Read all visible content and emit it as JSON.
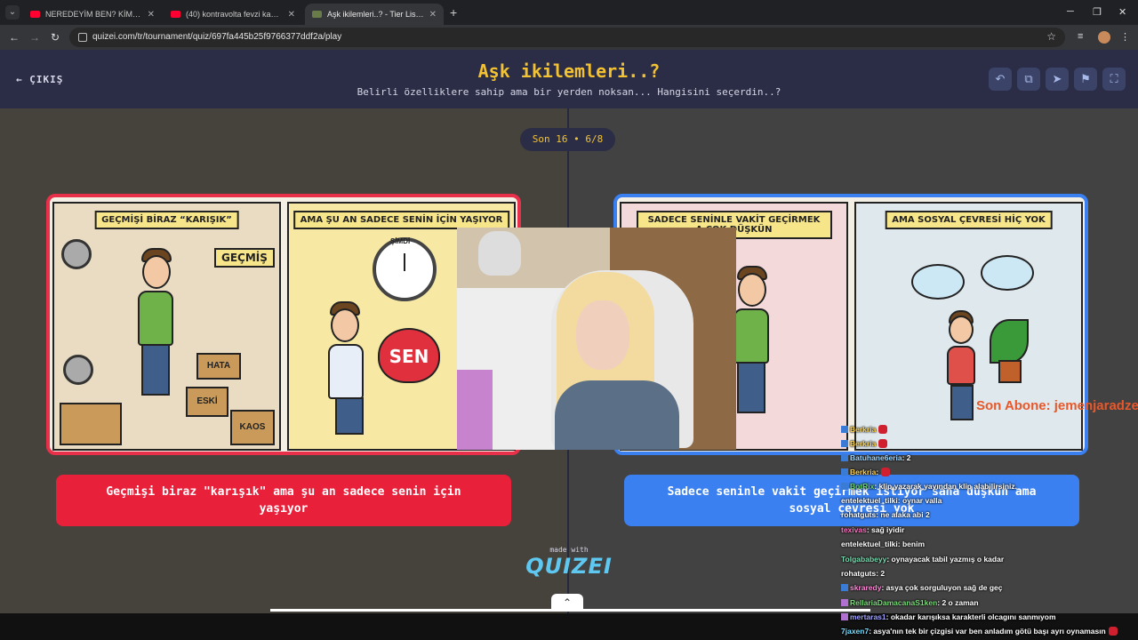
{
  "browser": {
    "tabs": [
      {
        "title": "NEREDEYİM BEN? KİMSE YOK İ...",
        "active": false
      },
      {
        "title": "(40) kontravolta fevzi kağıtları n...",
        "active": false
      },
      {
        "title": "Aşk ikilemleri..? - Tier List, Kör S...",
        "active": true
      }
    ],
    "url": "quizei.com/tr/tournament/quiz/697fa445b25f9766377ddf2a/play",
    "new_tab_label": "+",
    "minimize_label": "─",
    "restore_label": "❐",
    "close_label": "✕"
  },
  "header": {
    "exit_label": "ÇIKIŞ",
    "title": "Aşk ikilemleri..?",
    "subtitle": "Belirli özelliklere sahip ama bir yerden noksan... Hangisini seçerdin..?"
  },
  "counter": "Son 16 • 6/8",
  "left_card": {
    "panel1_caption": "GEÇMİŞİ BİRAZ “KARIŞIK”",
    "panel1_signs": [
      "GEÇMİŞ",
      "HATA",
      "ESKİ",
      "KAOS"
    ],
    "panel2_caption": "AMA ŞU AN SADECE SENİN İÇİN YAŞIYOR",
    "panel2_clock": "ŞİMDİ",
    "panel2_heart": "SEN"
  },
  "right_card": {
    "panel1_caption": "SADECE SENİNLE VAKİT GEÇİRMEK A ÇOK DÜŞKÜN",
    "panel2_caption": "AMA SOSYAL ÇEVRESİ HİÇ YOK"
  },
  "answers": {
    "left": "Geçmişi biraz \"karışık\" ama şu an sadece senin için yaşıyor",
    "right": "Sadece seninle vakit geçirmek istiyor sana düşkün ama sosyal çevresi yok"
  },
  "footer": {
    "made_with": "made with",
    "logo": "QUIZEI"
  },
  "stream_alert": "Son Abone: jemenjaradze",
  "chat": [
    {
      "user": "Berkria",
      "text": "",
      "color": "#ffd24a"
    },
    {
      "user": "Berkria",
      "text": "",
      "color": "#ffd24a"
    },
    {
      "user": "Batuhane6eria",
      "text": ": 2",
      "color": "#a0d8ff"
    },
    {
      "user": "Berkria",
      "text": ":",
      "color": "#ffd24a"
    },
    {
      "user": "BotRix",
      "text": ": klip yazarak yayından klip alabilirsiniz.",
      "color": "#6ad46a"
    },
    {
      "user": "entelektuel_tilki",
      "text": ": oynar valla",
      "color": "#ffffff"
    },
    {
      "user": "rohatguts",
      "text": ": ne alaka abi 2",
      "color": "#ffffff"
    },
    {
      "user": "texivas",
      "text": ": sağ iyidir",
      "color": "#ff70c0"
    },
    {
      "user": "entelektuel_tilki",
      "text": ": benim",
      "color": "#ffffff"
    },
    {
      "user": "Tolgababeyy",
      "text": ": oynayacak tabil yazmış o kadar",
      "color": "#7adcb0"
    },
    {
      "user": "rohatguts",
      "text": ": 2",
      "color": "#ffffff"
    },
    {
      "user": "skraredy",
      "text": ": asya çok sorguluyon sağ de geç",
      "color": "#ff8ad8"
    },
    {
      "user": "RellariaDamacanaS1ken",
      "text": ": 2 o zaman",
      "color": "#7adc7a"
    },
    {
      "user": "mertaras1",
      "text": ": okadar karışıksa karakterli olcagını sanmıyom",
      "color": "#a0a0ff"
    },
    {
      "user": "7jaxen7",
      "text": ": asya'nın tek bir çizgisi var ben anladım götü başı ayrı oynamasın",
      "color": "#7adcff"
    }
  ]
}
